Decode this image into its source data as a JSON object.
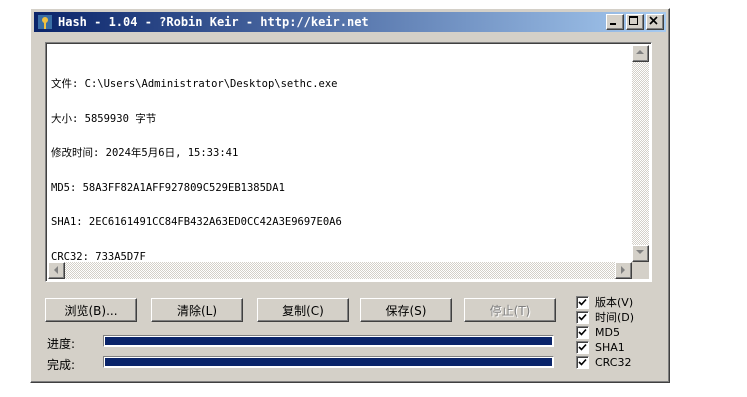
{
  "window": {
    "title": "Hash - 1.04 - ?Robin Keir - http://keir.net"
  },
  "output": {
    "lines": [
      "文件: C:\\Users\\Administrator\\Desktop\\sethc.exe",
      "大小: 5859930 字节",
      "修改时间: 2024年5月6日, 15:33:41",
      "MD5: 58A3FF82A1AFF927809C529EB1385DA1",
      "SHA1: 2EC6161491CC84FB432A63ED0CC42A3E9697E0A6",
      "CRC32: 733A5D7F"
    ]
  },
  "buttons": {
    "browse": "浏览(B)...",
    "clear": "清除(L)",
    "copy": "复制(C)",
    "save": "保存(S)",
    "stop": "停止(T)"
  },
  "progress": {
    "progress_label": "进度:",
    "complete_label": "完成:",
    "progress_value": 1.0,
    "complete_value": 1.0
  },
  "options": [
    {
      "label": "版本(V)",
      "checked": true
    },
    {
      "label": "时间(D)",
      "checked": true
    },
    {
      "label": "MD5",
      "checked": true
    },
    {
      "label": "SHA1",
      "checked": true
    },
    {
      "label": "CRC32",
      "checked": true
    }
  ]
}
